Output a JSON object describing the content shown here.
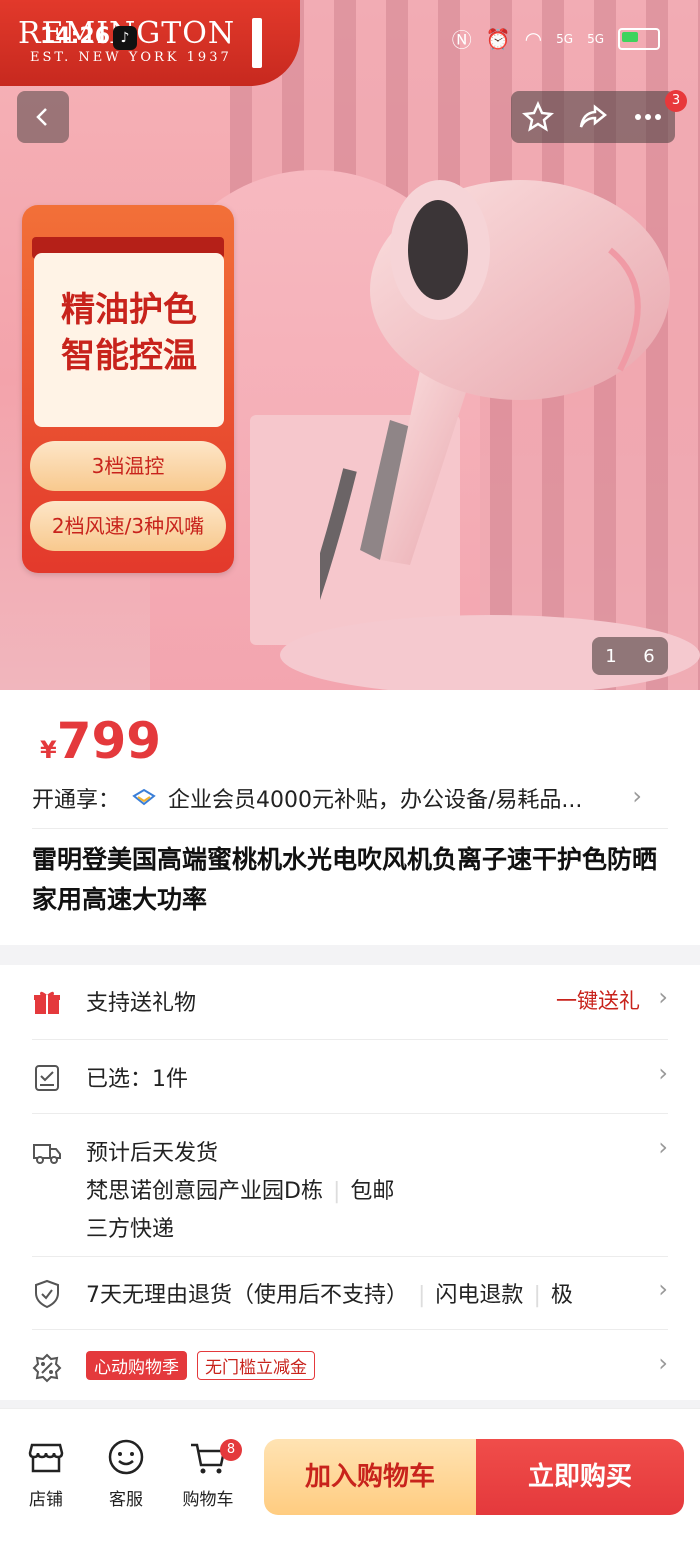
{
  "brand": {
    "name": "REMINGTON",
    "tagline": "EST. NEW YORK 1937"
  },
  "status_bar": {
    "time": "14:26",
    "network1": "5G",
    "network2": "5G",
    "app_icon": "tiktok-icon"
  },
  "header": {
    "back_icon": "chevron-left-icon",
    "favorite_icon": "star-icon",
    "share_icon": "share-icon",
    "more_icon": "more-dots-icon",
    "badge_count": "3"
  },
  "promo": {
    "headline_line1": "精油护色",
    "headline_line2": "智能控温",
    "feature1": "3档温控",
    "feature2": "2档风速/3种风嘴"
  },
  "gallery": {
    "current": "1",
    "total": "6"
  },
  "price": {
    "currency": "¥",
    "value": "799"
  },
  "member": {
    "label": "开通享：",
    "text": "企业会员4000元补贴，办公设备/易耗品..."
  },
  "product": {
    "title": "雷明登美国高端蜜桃机水光电吹风机负离子速干护色防晒家用高速大功率"
  },
  "rows": {
    "gift": {
      "label": "支持送礼物",
      "action": "一键送礼"
    },
    "selected": {
      "label": "已选：1件"
    },
    "shipping": {
      "line1": "预计后天发货",
      "location": "梵思诺创意园产业园D栋",
      "free": "包邮",
      "line3": "三方快递"
    },
    "returns": {
      "label": "7天无理由退货（使用后不支持）",
      "fast_refund": "闪电退款",
      "more": "极"
    },
    "promo": {
      "tag1": "心动购物季",
      "tag2": "无门槛立减金"
    }
  },
  "bottom_nav": {
    "shop": "店铺",
    "service": "客服",
    "cart": "购物车",
    "cart_count": "8"
  },
  "actions": {
    "add_to_cart": "加入购物车",
    "buy_now": "立即购买"
  },
  "colors": {
    "accent": "#e4393c",
    "brand_red": "#c7291f",
    "cart_button": "#ffcc80"
  }
}
